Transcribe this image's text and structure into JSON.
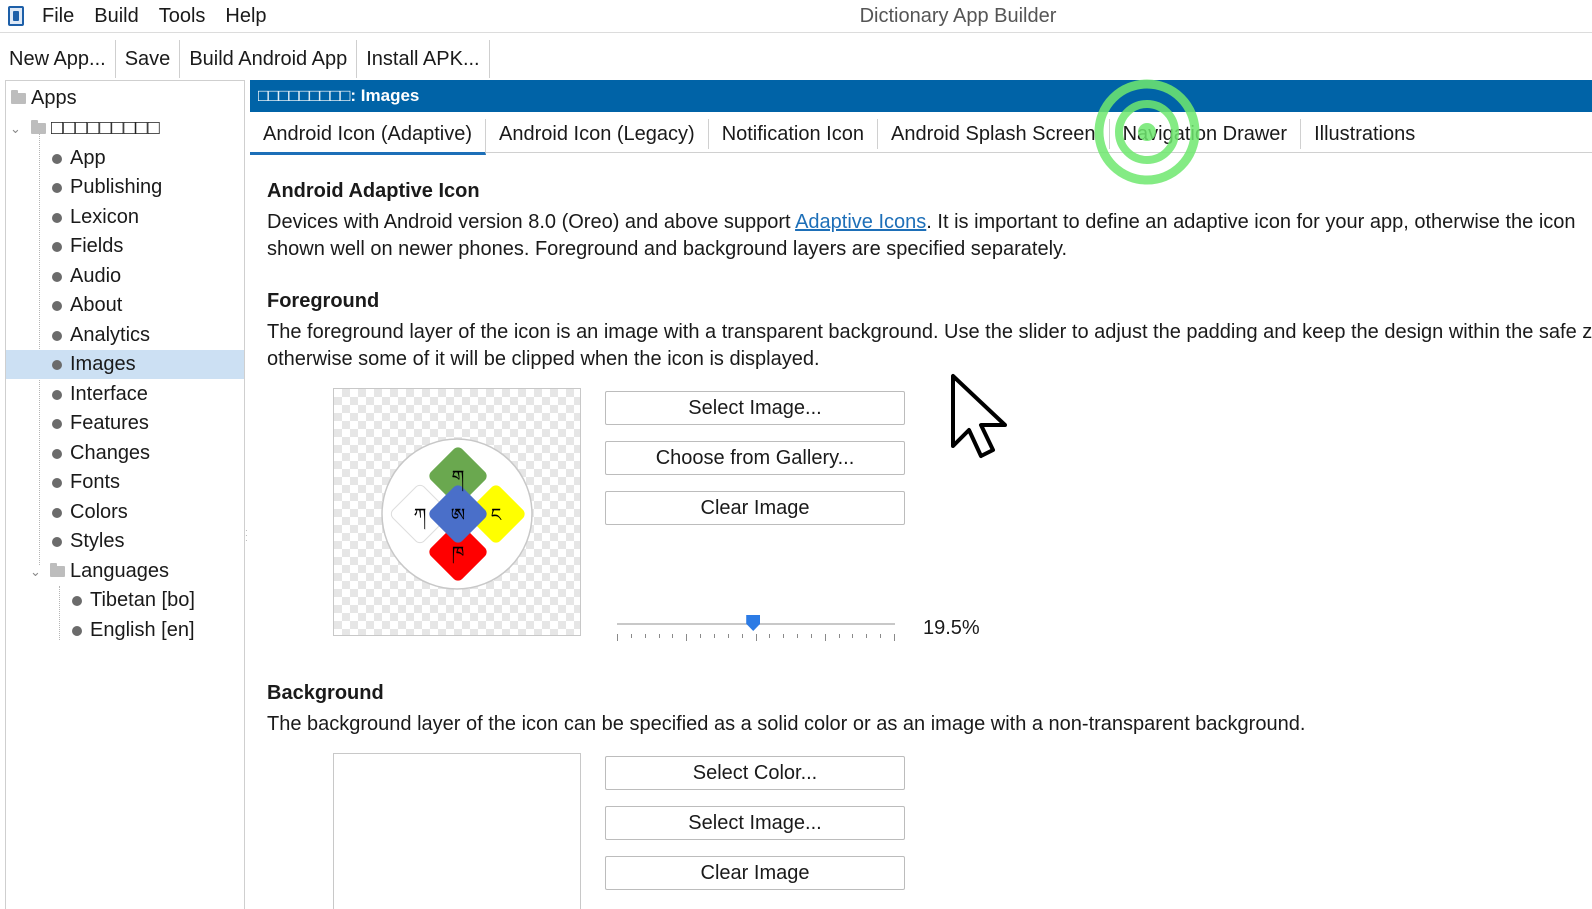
{
  "menu": {
    "items": [
      "File",
      "Build",
      "Tools",
      "Help"
    ],
    "window_title": "Dictionary App Builder"
  },
  "toolbar": {
    "buttons": [
      "New App...",
      "Save",
      "Build Android App",
      "Install APK..."
    ]
  },
  "tree": {
    "root_label": "Apps",
    "app_label": "□□□□□□□□□",
    "items": [
      "App",
      "Publishing",
      "Lexicon",
      "Fields",
      "Audio",
      "About",
      "Analytics",
      "Images",
      "Interface",
      "Features",
      "Changes",
      "Fonts",
      "Colors",
      "Styles"
    ],
    "selected": "Images",
    "languages_label": "Languages",
    "languages": [
      "Tibetan [bo]",
      "English [en]"
    ]
  },
  "header": {
    "title": "□□□□□□□□□: Images"
  },
  "tabs": [
    "Android Icon (Adaptive)",
    "Android Icon (Legacy)",
    "Notification Icon",
    "Android Splash Screen",
    "Navigation Drawer",
    "Illustrations"
  ],
  "active_tab": "Android Icon (Adaptive)",
  "adaptive": {
    "heading": "Android Adaptive Icon",
    "desc_pre": "Devices with Android version 8.0 (Oreo) and above support ",
    "desc_link": "Adaptive Icons",
    "desc_post": ". It is important to define an adaptive icon for your app, otherwise the icon",
    "desc_line2": "shown well on newer phones. Foreground and background layers are specified separately."
  },
  "foreground": {
    "heading": "Foreground",
    "desc_line1": "The foreground layer of the icon is an image with a transparent background. Use the slider to adjust the padding and keep the design within the safe z",
    "desc_line2": "otherwise some of it will be clipped when the icon is displayed.",
    "buttons": [
      "Select Image...",
      "Choose from Gallery...",
      "Clear Image"
    ],
    "padding_value_label": "19.5%",
    "padding_fraction": 0.49,
    "icon_glyphs": {
      "top": "ག",
      "left": "ཀ",
      "center": "ཨ",
      "right": "ང",
      "bottom": "ཁ"
    },
    "icon_colors": {
      "top": "#6aa84f",
      "left": "#ffffff",
      "center": "#4a6fc9",
      "right": "#ffff00",
      "bottom": "#ff0000"
    }
  },
  "background": {
    "heading": "Background",
    "desc": "The background layer of the icon can be specified as a solid color or as an image with a non-transparent background.",
    "buttons": [
      "Select Color...",
      "Select Image...",
      "Clear Image"
    ]
  },
  "colors": {
    "header_bar": "#0063a7",
    "selection": "#cce0f3",
    "link": "#1d6fb8",
    "click_indicator": "#6ee86e"
  }
}
